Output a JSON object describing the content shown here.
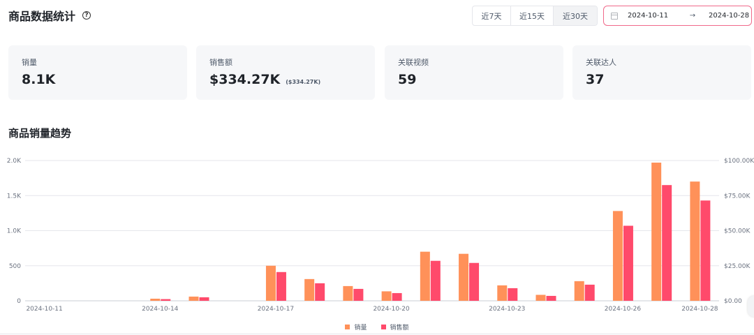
{
  "header": {
    "title": "商品数据统计",
    "help_icon": "question-circle-icon"
  },
  "range_tabs": [
    "近7天",
    "近15天",
    "近30天"
  ],
  "date_range": {
    "start": "2024-10-11",
    "separator": "→",
    "end": "2024-10-28",
    "icon": "calendar-icon",
    "border_color": "#f0698a"
  },
  "stats": [
    {
      "label": "销量",
      "value": "8.1K",
      "sub": ""
    },
    {
      "label": "销售额",
      "value": "$334.27K",
      "sub": "($334.27K)"
    },
    {
      "label": "关联视频",
      "value": "59",
      "sub": ""
    },
    {
      "label": "关联达人",
      "value": "37",
      "sub": ""
    }
  ],
  "section_title": "商品销量趋势",
  "chart_data": {
    "type": "bar",
    "title": "",
    "categories": [
      "2024-10-11",
      "2024-10-12",
      "2024-10-13",
      "2024-10-14",
      "2024-10-15",
      "2024-10-16",
      "2024-10-17",
      "2024-10-18",
      "2024-10-19",
      "2024-10-20",
      "2024-10-21",
      "2024-10-22",
      "2024-10-23",
      "2024-10-24",
      "2024-10-25",
      "2024-10-26",
      "2024-10-27",
      "2024-10-28"
    ],
    "x_tick_labels": [
      "2024-10-11",
      "2024-10-14",
      "2024-10-17",
      "2024-10-20",
      "2024-10-23",
      "2024-10-26",
      "2024-10-28"
    ],
    "series": [
      {
        "name": "销量",
        "axis": "left",
        "color": "#ff9159",
        "values": [
          0,
          0,
          0,
          30,
          60,
          0,
          500,
          310,
          210,
          135,
          700,
          670,
          220,
          85,
          280,
          1280,
          1970,
          1700
        ]
      },
      {
        "name": "销售额",
        "axis": "right",
        "color": "#ff4a6b",
        "values": [
          0,
          0,
          0,
          1200,
          2500,
          0,
          20500,
          12500,
          8500,
          5500,
          28500,
          27000,
          9000,
          3500,
          11500,
          53500,
          82500,
          71500
        ]
      }
    ],
    "y_left": {
      "ticks": [
        0,
        500,
        1000,
        1500,
        2000
      ],
      "tick_labels": [
        "0",
        "500",
        "1.0K",
        "1.5K",
        "2.0K"
      ],
      "range": [
        0,
        2000
      ]
    },
    "y_right": {
      "ticks": [
        0,
        25000,
        50000,
        75000,
        100000
      ],
      "tick_labels": [
        "$0.00",
        "$25.00K",
        "$50.00K",
        "$75.00K",
        "$100.00K"
      ],
      "range": [
        0,
        100000
      ]
    },
    "grid": true,
    "legend_position": "bottom-center"
  }
}
